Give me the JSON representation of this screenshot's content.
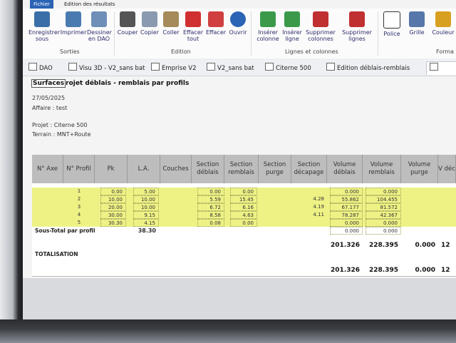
{
  "ribbon": {
    "tab_file": "Fichier",
    "tab_edit": "Edition des résultats",
    "buttons": [
      {
        "label": "Enregistrer sous",
        "icon": "save-icon",
        "color": "#3a6ea8"
      },
      {
        "label": "Imprimer",
        "icon": "printer-icon",
        "color": "#4a7bb0"
      },
      {
        "label": "Dessiner en DAO",
        "icon": "draw-icon",
        "color": "#6f8fb8"
      },
      {
        "label": "Couper",
        "icon": "scissors-icon",
        "color": "#555555"
      },
      {
        "label": "Copier",
        "icon": "copy-icon",
        "color": "#8a9bb0"
      },
      {
        "label": "Coller",
        "icon": "paste-icon",
        "color": "#a58a5a"
      },
      {
        "label": "Effacer tout",
        "icon": "clear-all-icon",
        "color": "#d03030"
      },
      {
        "label": "Effacer",
        "icon": "clear-icon",
        "color": "#d04040"
      },
      {
        "label": "Ouvrir",
        "icon": "open-icon",
        "color": "#2b63b5"
      },
      {
        "label": "Insérer colonne",
        "icon": "insert-column-icon",
        "color": "#3a9a4a"
      },
      {
        "label": "Insérer ligne",
        "icon": "insert-row-icon",
        "color": "#3a9a4a"
      },
      {
        "label": "Supprimer colonnes",
        "icon": "delete-columns-icon",
        "color": "#c03030"
      },
      {
        "label": "Supprimer lignes",
        "icon": "delete-rows-icon",
        "color": "#c03030"
      },
      {
        "label": "Police",
        "icon": "font-icon",
        "color": "#333333"
      },
      {
        "label": "Grille",
        "icon": "grid-icon",
        "color": "#5577aa"
      },
      {
        "label": "Couleur",
        "icon": "color-icon",
        "color": "#d8a020"
      }
    ],
    "groups": [
      "Sorties",
      "Edition",
      "Lignes et colonnes",
      "Forma"
    ]
  },
  "doc_tabs": [
    {
      "label": "DAO",
      "active": false
    },
    {
      "label": "Visu 3D - V2_sans bat",
      "active": false
    },
    {
      "label": "Emprise V2",
      "active": false
    },
    {
      "label": "V2_sans bat",
      "active": false
    },
    {
      "label": "Citerne 500",
      "active": false
    },
    {
      "label": "Edition déblais-remblais",
      "active": false
    },
    {
      "label": "",
      "active": true
    }
  ],
  "report": {
    "title_box": "Surfaces",
    "title_rest": "rojet déblais - remblais par profils",
    "date": "27/05/2025",
    "affaire": "Affaire :  test",
    "projet": "Projet :  Citerne 500",
    "terrain": "Terrain :  MNT+Route"
  },
  "table": {
    "headers": [
      "N° Axe",
      "N° Profil",
      "Pk",
      "L.A.",
      "Couches",
      "Section déblais",
      "Section remblais",
      "Section purge",
      "Section décapage",
      "Volume déblais",
      "Volume remblais",
      "Volume purge",
      "V déc"
    ],
    "rows": [
      {
        "profil": "1",
        "pk": "0.00",
        "la": "5.00",
        "deb": "0.00",
        "rem": "0.00",
        "purge": "",
        "decap": "",
        "vdeb": "0.000",
        "vrem": "0.000"
      },
      {
        "profil": "2",
        "pk": "10.00",
        "la": "10.00",
        "deb": "5.59",
        "rem": "15.45",
        "purge": "",
        "decap": "4.28",
        "vdeb": "55.862",
        "vrem": "104.455"
      },
      {
        "profil": "3",
        "pk": "20.00",
        "la": "10.00",
        "deb": "6.72",
        "rem": "6.16",
        "purge": "",
        "decap": "4.19",
        "vdeb": "67.177",
        "vrem": "81.572"
      },
      {
        "profil": "4",
        "pk": "30.00",
        "la": "9.15",
        "deb": "8.58",
        "rem": "4.63",
        "purge": "",
        "decap": "4.11",
        "vdeb": "78.287",
        "vrem": "42.367"
      },
      {
        "profil": "5",
        "pk": "30.30",
        "la": "4.15",
        "deb": "0.08",
        "rem": "0.00",
        "purge": "",
        "decap": "",
        "vdeb": "0.000",
        "vrem": "0.000"
      }
    ],
    "subtotal": {
      "label": "Sous-Total par profil",
      "la": "38.30",
      "vdeb": "201.326",
      "vrem": "228.395",
      "vpurge": "0.000",
      "vdec": "12"
    },
    "total": {
      "label": "TOTALISATION"
    },
    "grand": {
      "vdeb": "201.326",
      "vrem": "228.395",
      "vpurge": "0.000",
      "vdec": "12"
    }
  }
}
